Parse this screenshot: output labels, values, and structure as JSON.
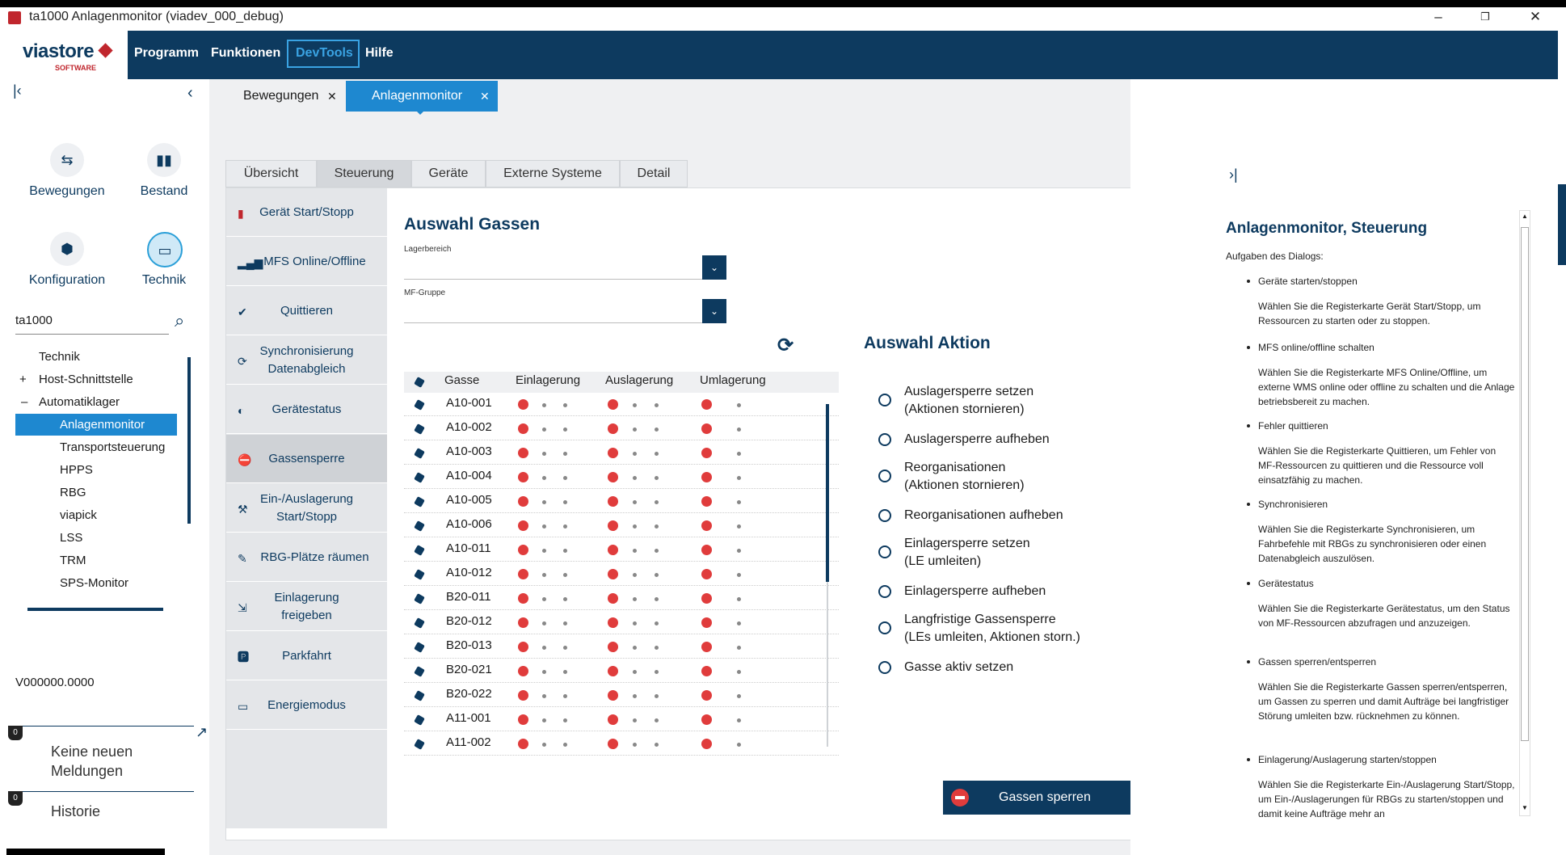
{
  "window": {
    "title": "ta1000 Anlagenmonitor (viadev_000_debug)",
    "minimize": "–",
    "restore": "❐",
    "close": "✕"
  },
  "logo": {
    "brand": "viastore",
    "sub": "SOFTWARE"
  },
  "menu": [
    "Programm",
    "Funktionen",
    "DevTools",
    "Hilfe"
  ],
  "sidebar": {
    "nav": [
      {
        "label": "Bewegungen",
        "icon": "swap-icon"
      },
      {
        "label": "Bestand",
        "icon": "bar-chart-icon"
      },
      {
        "label": "Konfiguration",
        "icon": "hexagons-icon"
      },
      {
        "label": "Technik",
        "icon": "monitor-icon"
      }
    ],
    "search_value": "ta1000",
    "tree": [
      "Technik",
      "Host-Schnittstelle",
      "Automatiklager",
      "Anlagenmonitor",
      "Transportsteuerung",
      "HPPS",
      "RBG",
      "viapick",
      "LSS",
      "TRM",
      "SPS-Monitor"
    ],
    "tree_expand": [
      "+",
      "–"
    ],
    "version": "V000000.0000",
    "badge_count": "0",
    "messages": "Keine neuen Meldungen",
    "history": "Historie"
  },
  "tabs": [
    {
      "label": "Bewegungen",
      "close": "✕"
    },
    {
      "label": "Anlagenmonitor",
      "close": "✕"
    }
  ],
  "subtabs": [
    "Übersicht",
    "Steuerung",
    "Geräte",
    "Externe Systeme",
    "Detail"
  ],
  "leftnav": [
    {
      "label": "Gerät Start/Stopp",
      "icon": "traffic-light-icon"
    },
    {
      "label": "MFS Online/Offline",
      "icon": "signal-icon"
    },
    {
      "label": "Quittieren",
      "icon": "check-icon"
    },
    {
      "label": "Synchronisierung Datenabgleich",
      "icon": "sync-icon"
    },
    {
      "label": "Gerätestatus",
      "icon": "toggle-icon"
    },
    {
      "label": "Gassensperre",
      "icon": "no-entry-icon"
    },
    {
      "label": "Ein-/Auslagerung Start/Stopp",
      "icon": "forklift-icon"
    },
    {
      "label": "RBG-Plätze räumen",
      "icon": "brush-icon"
    },
    {
      "label": "Einlagerung freigeben",
      "icon": "release-icon"
    },
    {
      "label": "Parkfahrt",
      "icon": "parking-icon"
    },
    {
      "label": "Energiemodus",
      "icon": "battery-icon"
    }
  ],
  "gassen": {
    "title": "Auswahl Gassen",
    "lagerbereich_label": "Lagerbereich",
    "lagerbereich_value": "",
    "mfgruppe_label": "MF-Gruppe",
    "mfgruppe_value": "",
    "headers": [
      "Gasse",
      "Einlagerung",
      "Auslagerung",
      "Umlagerung"
    ],
    "rows": [
      "A10-001",
      "A10-002",
      "A10-003",
      "A10-004",
      "A10-005",
      "A10-006",
      "A10-011",
      "A10-012",
      "B20-011",
      "B20-012",
      "B20-013",
      "B20-021",
      "B20-022",
      "A11-001",
      "A11-002"
    ],
    "status_color": "#e03c3c"
  },
  "aktion": {
    "title": "Auswahl Aktion",
    "options": [
      [
        "Auslagersperre setzen",
        "(Aktionen stornieren)"
      ],
      [
        "Auslagersperre aufheben",
        ""
      ],
      [
        "Reorganisationen",
        "(Aktionen stornieren)"
      ],
      [
        "Reorganisationen aufheben",
        ""
      ],
      [
        "Einlagersperre setzen",
        "(LE umleiten)"
      ],
      [
        "Einlagersperre aufheben",
        ""
      ],
      [
        "Langfristige Gassensperre",
        "(LEs umleiten, Aktionen storn.)"
      ],
      [
        "Gasse aktiv setzen",
        ""
      ]
    ],
    "button": "Gassen sperren"
  },
  "help": {
    "title": "Anlagenmonitor, Steuerung",
    "intro": "Aufgaben des Dialogs:",
    "items": [
      {
        "head": "Geräte starten/stoppen",
        "text": "Wählen Sie die Registerkarte Gerät Start/Stopp, um Ressourcen zu starten oder zu stoppen."
      },
      {
        "head": "MFS online/offline schalten",
        "text": "Wählen Sie die Registerkarte MFS Online/Offline, um externe WMS online oder offline zu schalten und die Anlage betriebsbereit zu machen."
      },
      {
        "head": "Fehler quittieren",
        "text": "Wählen Sie die Registerkarte Quittieren, um Fehler von MF-Ressourcen zu quittieren und die Ressource voll einsatzfähig zu machen."
      },
      {
        "head": "Synchronisieren",
        "text": "Wählen Sie die Registerkarte Synchronisieren, um Fahrbefehle mit RBGs zu synchronisieren oder einen Datenabgleich auszulösen."
      },
      {
        "head": "Gerätestatus",
        "text": "Wählen Sie die Registerkarte Gerätestatus, um den Status von MF-Ressourcen abzufragen und anzuzeigen."
      },
      {
        "head": "Gassen sperren/entsperren",
        "text": "Wählen Sie die Registerkarte Gassen sperren/entsperren, um Gassen zu sperren und damit Aufträge bei langfristiger Störung umleiten bzw. rücknehmen zu können."
      },
      {
        "head": "Einlagerung/Auslagerung starten/stoppen",
        "text": "Wählen Sie die Registerkarte Ein-/Auslagerung Start/Stopp, um Ein-/Auslagerungen für RBGs zu starten/stoppen und damit keine Aufträge mehr an"
      }
    ]
  }
}
